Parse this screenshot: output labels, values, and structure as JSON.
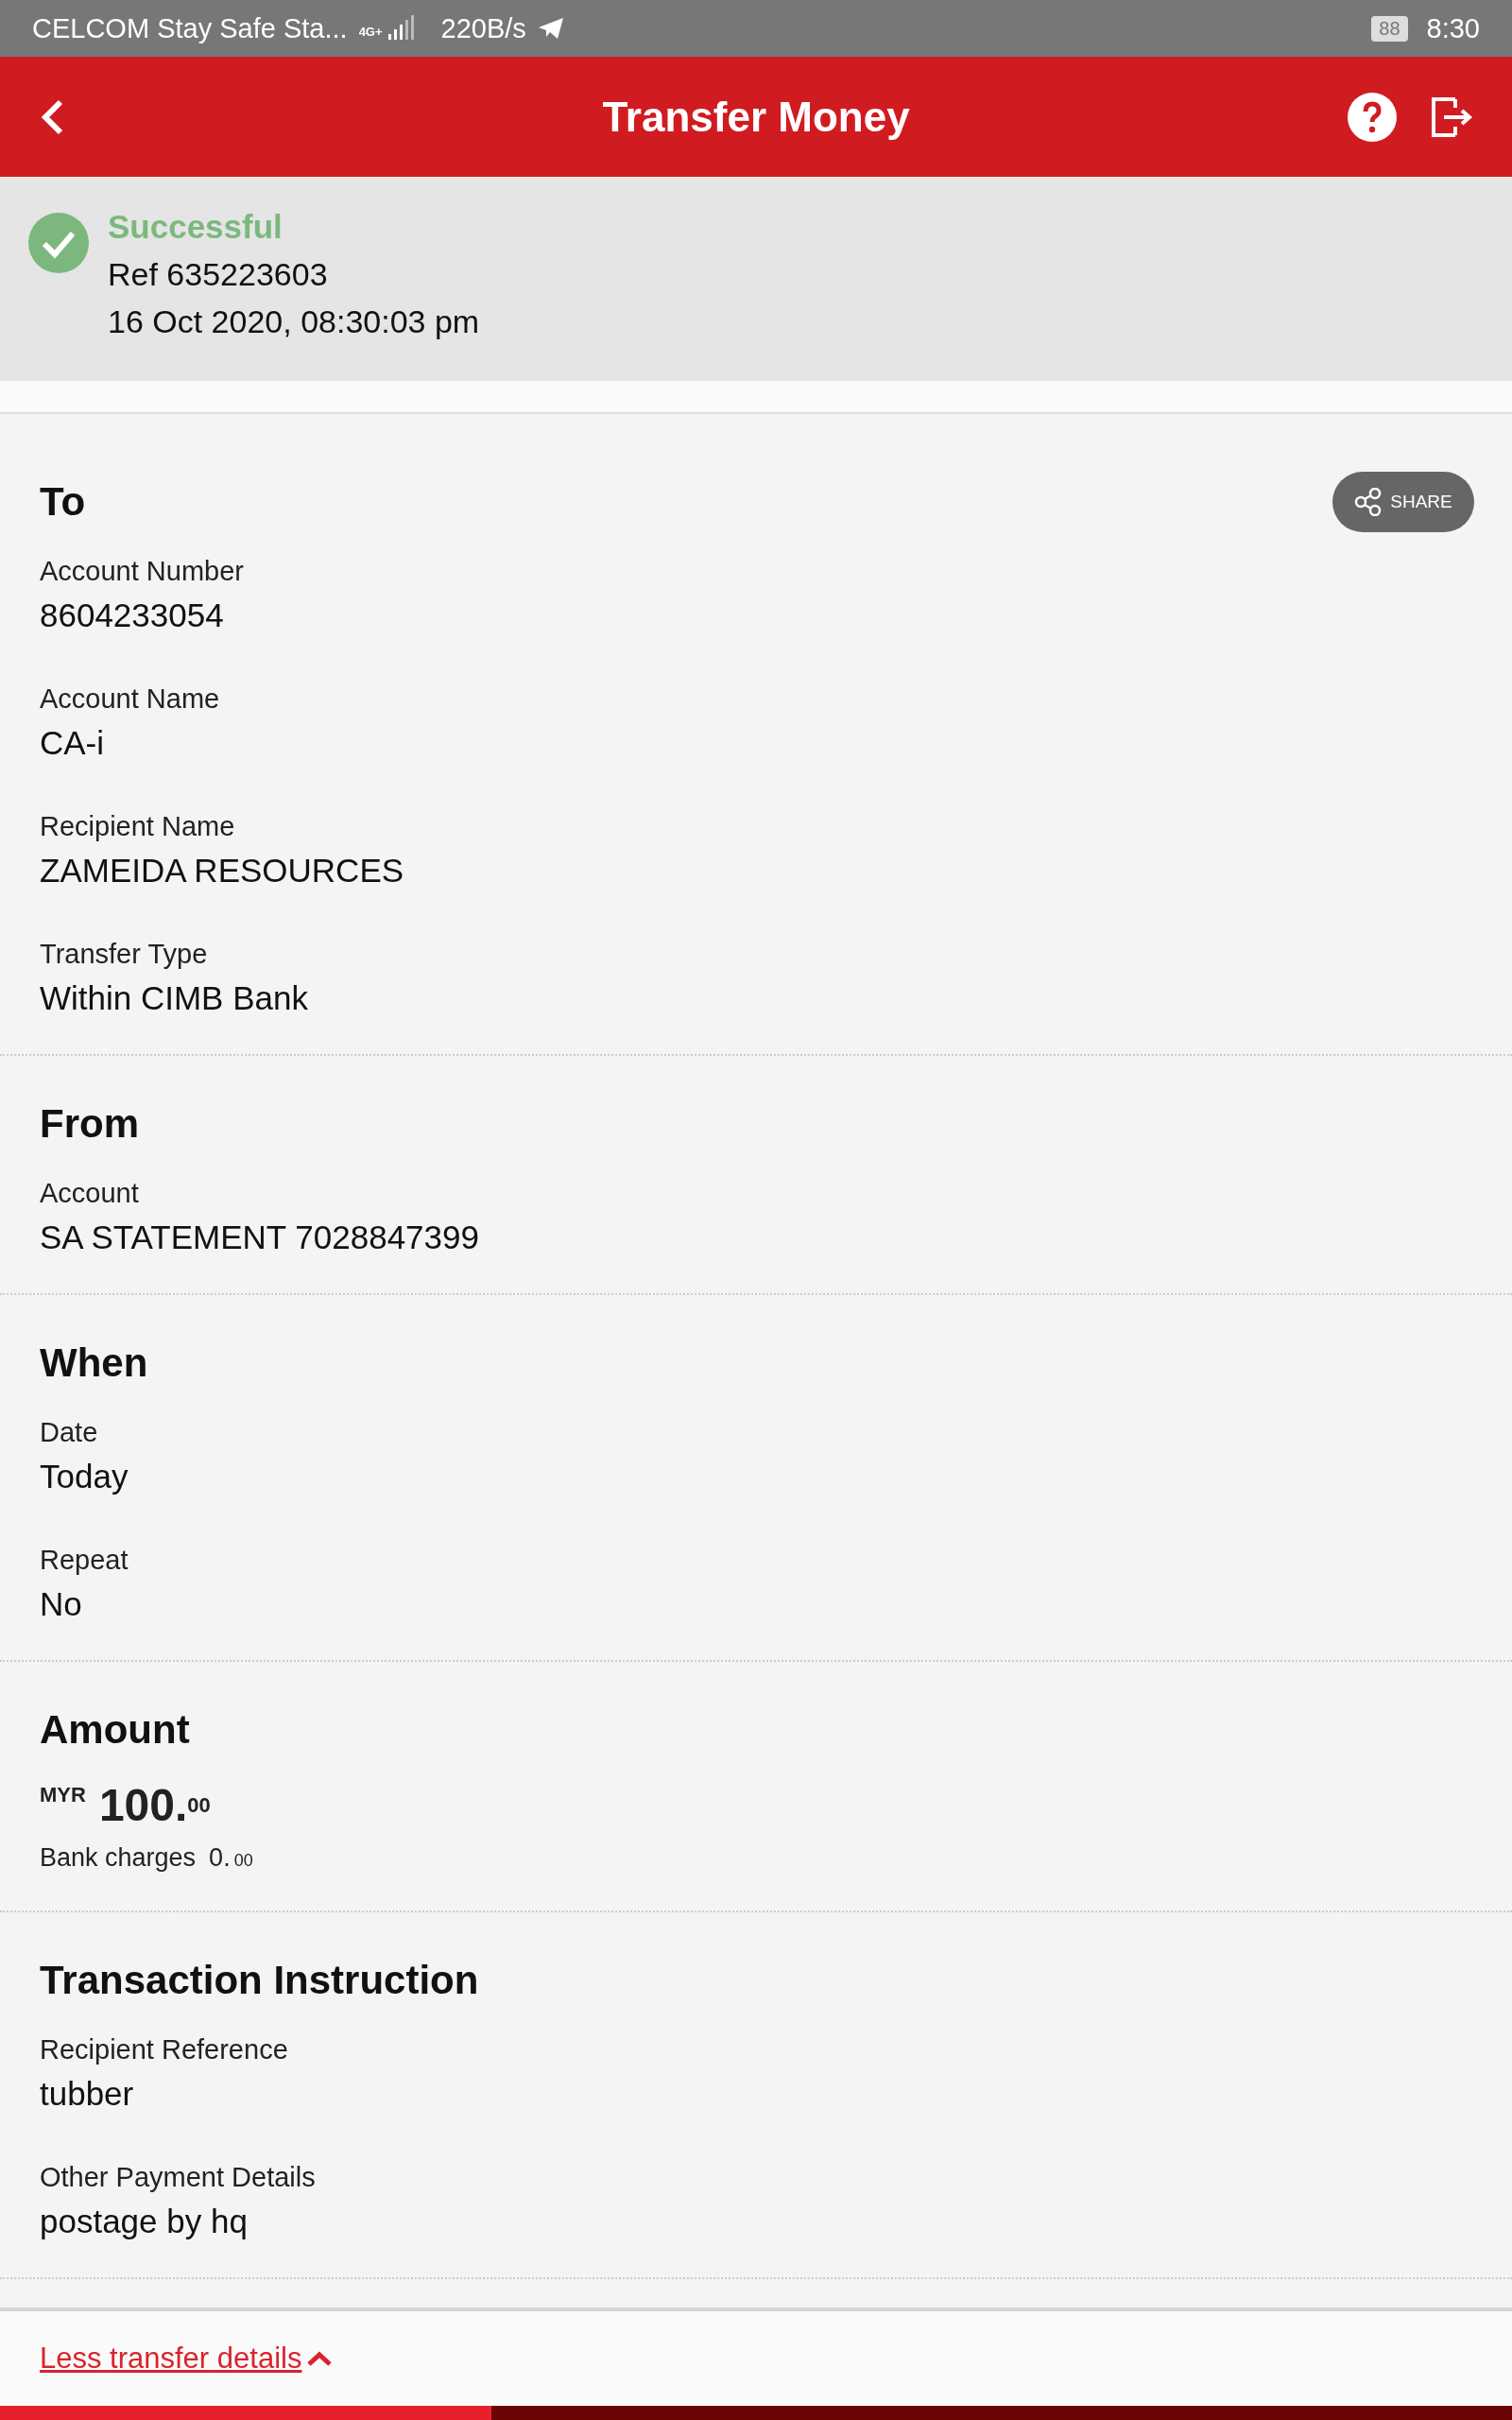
{
  "status_bar": {
    "carrier": "CELCOM Stay Safe Sta...",
    "network": "4G+",
    "speed": "220B/s",
    "battery": "88",
    "time": "8:30"
  },
  "header": {
    "title": "Transfer Money"
  },
  "result": {
    "status": "Successful",
    "reference": "Ref 635223603",
    "datetime": "16 Oct 2020, 08:30:03 pm"
  },
  "sections": [
    {
      "kind": "fields",
      "heading": "To",
      "share_label": "SHARE",
      "fields": [
        {
          "label": "Account Number",
          "value": "8604233054"
        },
        {
          "label": "Account Name",
          "value": "CA-i"
        },
        {
          "label": "Recipient Name",
          "value": "ZAMEIDA RESOURCES"
        },
        {
          "label": "Transfer Type",
          "value": "Within CIMB Bank"
        }
      ]
    },
    {
      "kind": "fields",
      "heading": "From",
      "fields": [
        {
          "label": "Account",
          "value": "SA STATEMENT 7028847399"
        }
      ]
    },
    {
      "kind": "fields",
      "heading": "When",
      "fields": [
        {
          "label": "Date",
          "value": "Today"
        },
        {
          "label": "Repeat",
          "value": "No"
        }
      ]
    },
    {
      "kind": "amount",
      "heading": "Amount",
      "currency": "MYR",
      "whole": "100.",
      "cents": "00",
      "charges_label": "Bank charges",
      "charges_whole": "0.",
      "charges_cents": "00"
    },
    {
      "kind": "fields",
      "heading": "Transaction Instruction",
      "fields": [
        {
          "label": "Recipient Reference",
          "value": "tubber"
        },
        {
          "label": "Other Payment Details",
          "value": "postage by hq"
        }
      ]
    }
  ],
  "footer": {
    "link": "Less transfer details"
  }
}
